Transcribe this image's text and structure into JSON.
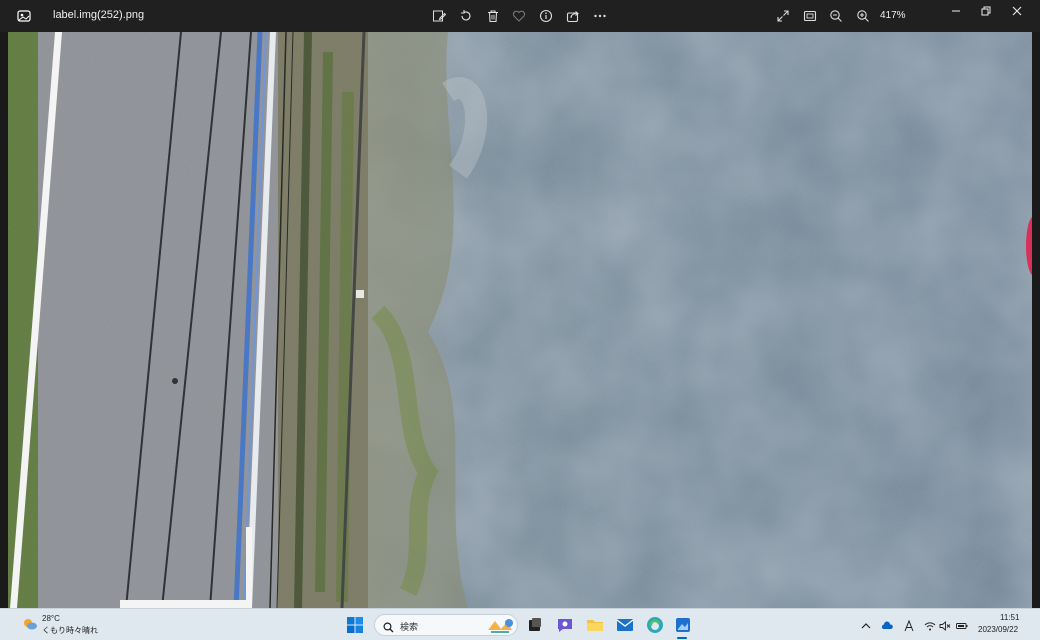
{
  "titlebar": {
    "filename": "label.img(252).png",
    "zoom": "417%",
    "tools": [
      "edit-image-icon",
      "rotate-icon",
      "delete-icon",
      "favorite-icon",
      "info-icon",
      "share-icon",
      "more-icon"
    ],
    "view_tools": [
      "fullscreen-icon",
      "fit-window-icon",
      "zoom-out-icon",
      "zoom-in-icon"
    ]
  },
  "taskbar": {
    "weather_temp": "28°C",
    "weather_desc": "くもり時々晴れ",
    "search_placeholder": "検索",
    "time": "11:51",
    "date": "2023/09/22",
    "apps": [
      "task-view-icon",
      "chat-icon",
      "file-explorer-icon",
      "mail-icon",
      "edge-icon",
      "photos-icon"
    ]
  },
  "colors": {
    "titlebar_bg": "#202020",
    "taskbar_bg": "#dfe8ef",
    "accent": "#0067c0"
  }
}
